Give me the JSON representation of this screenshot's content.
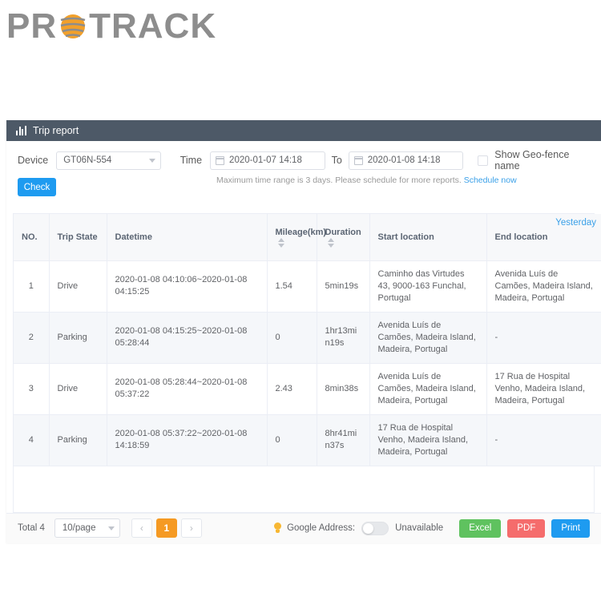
{
  "brand": {
    "name_left": "PR",
    "name_right": "TRACK",
    "logo_color": "#f2a02a",
    "text_color": "#8d8d8d"
  },
  "panel": {
    "title": "Trip report",
    "title_icon": "bar-chart-icon",
    "title_bg": "#4d5967"
  },
  "filters": {
    "device_label": "Device",
    "device_value": "GT06N-554",
    "time_label": "Time",
    "time_from": "2020-01-07 14:18",
    "time_to_label": "To",
    "time_to": "2020-01-08 14:18",
    "geofence_label": "Show Geo-fence name",
    "geofence_checked": false,
    "hint_text": "Maximum time range is 3 days. Please schedule for more reports.",
    "hint_link": "Schedule now",
    "check_button": "Check",
    "yesterday_link": "Yesterday"
  },
  "table": {
    "columns": [
      {
        "key": "no",
        "label": "NO.",
        "sortable": false
      },
      {
        "key": "state",
        "label": "Trip State",
        "sortable": false
      },
      {
        "key": "datetime",
        "label": "Datetime",
        "sortable": false
      },
      {
        "key": "mileage",
        "label": "Mileage(km)",
        "sortable": true
      },
      {
        "key": "duration",
        "label": "Duration",
        "sortable": true
      },
      {
        "key": "start",
        "label": "Start location",
        "sortable": false
      },
      {
        "key": "end",
        "label": "End location",
        "sortable": false
      }
    ],
    "rows": [
      {
        "no": "1",
        "state": "Drive",
        "datetime": "2020-01-08 04:10:06~2020-01-08 04:15:25",
        "mileage": "1.54",
        "duration": "5min19s",
        "start": "Caminho das Virtudes 43, 9000-163 Funchal, Portugal",
        "end": "Avenida Luís de Camões, Madeira Island, Madeira, Portugal"
      },
      {
        "no": "2",
        "state": "Parking",
        "datetime": "2020-01-08 04:15:25~2020-01-08 05:28:44",
        "mileage": "0",
        "duration": "1hr13min19s",
        "start": "Avenida Luís de Camões, Madeira Island, Madeira, Portugal",
        "end": "-"
      },
      {
        "no": "3",
        "state": "Drive",
        "datetime": "2020-01-08 05:28:44~2020-01-08 05:37:22",
        "mileage": "2.43",
        "duration": "8min38s",
        "start": "Avenida Luís de Camões, Madeira Island, Madeira, Portugal",
        "end": "17 Rua de Hospital Venho, Madeira Island, Madeira, Portugal"
      },
      {
        "no": "4",
        "state": "Parking",
        "datetime": "2020-01-08 05:37:22~2020-01-08 14:18:59",
        "mileage": "0",
        "duration": "8hr41min37s",
        "start": "17 Rua de Hospital Venho, Madeira Island, Madeira, Portugal",
        "end": "-"
      }
    ]
  },
  "footer": {
    "total": "Total 4",
    "page_size": "10/page",
    "prev": "‹",
    "next": "›",
    "current_page": "1",
    "google_address_label": "Google Address:",
    "google_address_state": "Unavailable",
    "google_address_on": false,
    "excel_button": "Excel",
    "pdf_button": "PDF",
    "print_button": "Print",
    "excel_color": "#5fc25f",
    "pdf_color": "#f56c6c",
    "print_color": "#1e9bf0",
    "active_page_color": "#f59a23"
  }
}
